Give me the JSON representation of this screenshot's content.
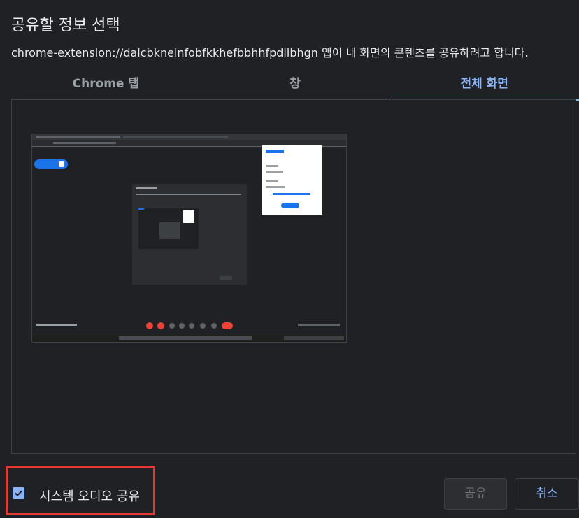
{
  "dialog": {
    "title": "공유할 정보 선택",
    "subtitle": "chrome-extension://dalcbknelnfobfkkhefbbhhfpdiibhgn 앱이 내 화면의 콘텐츠를 공유하려고 합니다."
  },
  "tabs": [
    {
      "label": "Chrome 탭"
    },
    {
      "label": "창"
    },
    {
      "label": "전체 화면",
      "active": true
    }
  ],
  "footer": {
    "audio_label": "시스템 오디오 공유",
    "audio_checked": true,
    "share_label": "공유",
    "cancel_label": "취소"
  },
  "colors": {
    "background": "#202124",
    "accent": "#8ab4f8",
    "highlight_box": "#e53935"
  }
}
